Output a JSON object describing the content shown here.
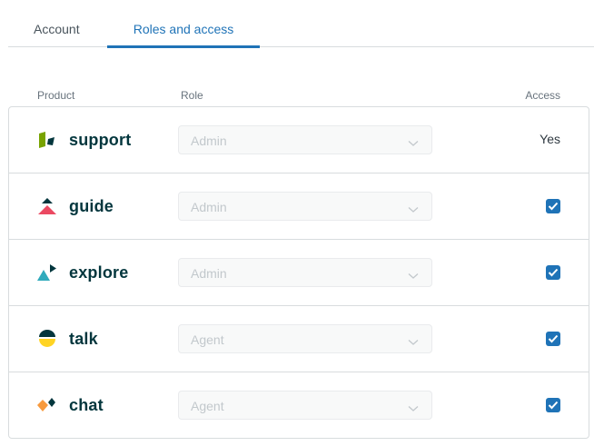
{
  "tabs": [
    {
      "label": "Account",
      "active": false
    },
    {
      "label": "Roles and access",
      "active": true
    }
  ],
  "columns": {
    "product": "Product",
    "role": "Role",
    "access": "Access"
  },
  "colors": {
    "accent": "#1f73b7",
    "brand_text": "#03363d"
  },
  "rows": [
    {
      "product": "support",
      "icon": "support-logo-icon",
      "role": "Admin",
      "access_text": "Yes",
      "access_checked": null
    },
    {
      "product": "guide",
      "icon": "guide-logo-icon",
      "role": "Admin",
      "access_text": null,
      "access_checked": true
    },
    {
      "product": "explore",
      "icon": "explore-logo-icon",
      "role": "Admin",
      "access_text": null,
      "access_checked": true
    },
    {
      "product": "talk",
      "icon": "talk-logo-icon",
      "role": "Agent",
      "access_text": null,
      "access_checked": true
    },
    {
      "product": "chat",
      "icon": "chat-logo-icon",
      "role": "Agent",
      "access_text": null,
      "access_checked": true
    }
  ]
}
